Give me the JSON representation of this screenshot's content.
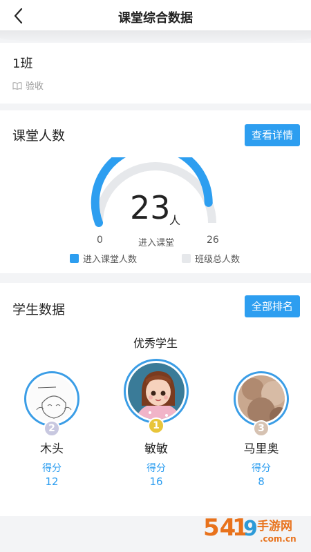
{
  "header": {
    "title": "课堂综合数据",
    "back_icon": "chevron-left-icon"
  },
  "class_info": {
    "name": "1班",
    "status": "验收",
    "status_icon": "book-icon"
  },
  "class_count": {
    "title": "课堂人数",
    "details_button": "查看详情",
    "entered": "23",
    "unit": "人",
    "min": "0",
    "center_label": "进入课堂",
    "total": "26",
    "entered_value": 23,
    "total_value": 26,
    "legend": [
      {
        "label": "进入课堂人数",
        "color": "#2d9ef0"
      },
      {
        "label": "班级总人数",
        "color": "#e6e8eb"
      }
    ]
  },
  "student_data": {
    "title": "学生数据",
    "ranking_button": "全部排名",
    "subtitle": "优秀学生",
    "students": [
      {
        "rank": "2",
        "name": "木头",
        "score_label": "得分",
        "score": "12",
        "badge_color": "#c8c8e0"
      },
      {
        "rank": "1",
        "name": "敏敏",
        "score_label": "得分",
        "score": "16",
        "badge_color": "#e8c53a"
      },
      {
        "rank": "3",
        "name": "马里奥",
        "score_label": "得分",
        "score": "8",
        "badge_color": "#d6c2b2"
      }
    ]
  },
  "watermark": {
    "text": "5419手游网",
    "subtext": ".com.cn"
  }
}
